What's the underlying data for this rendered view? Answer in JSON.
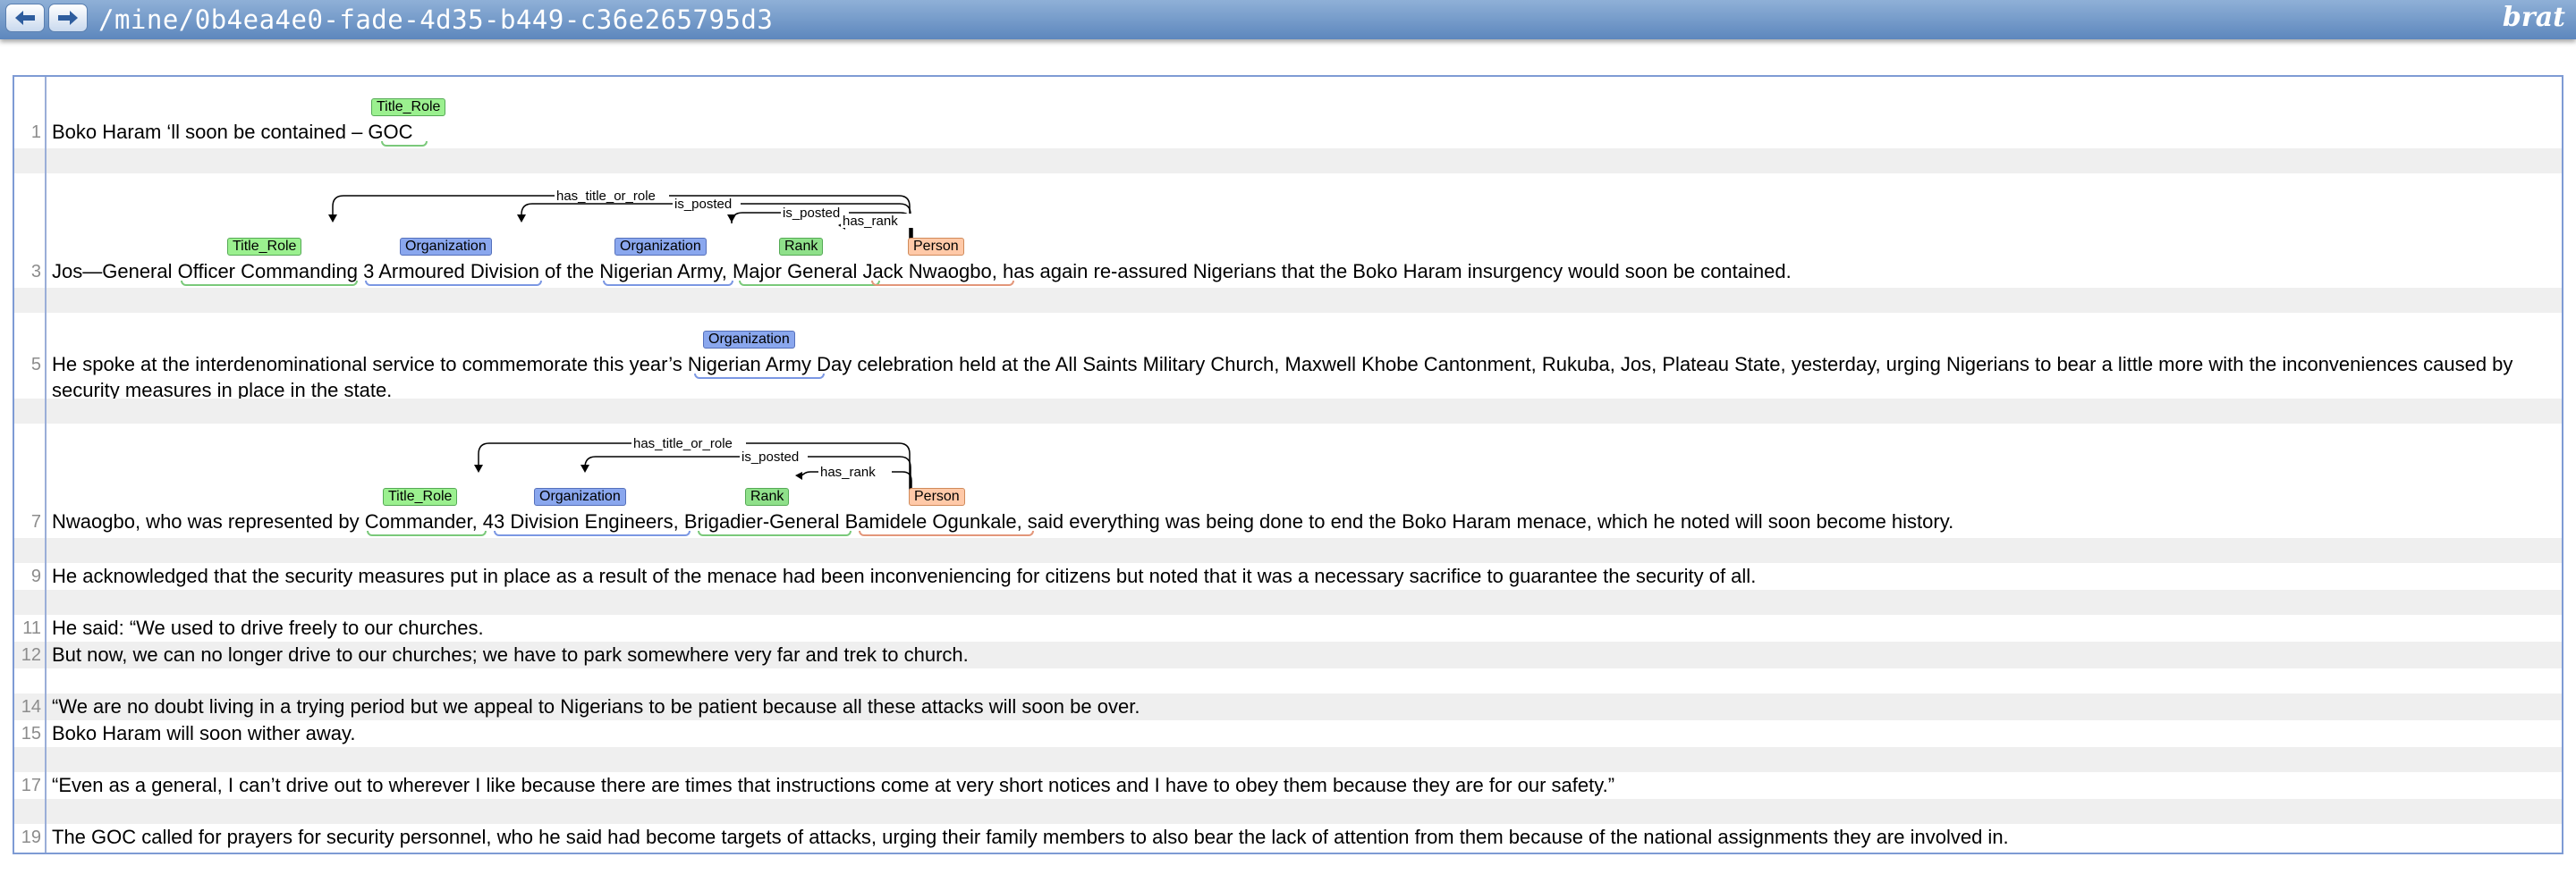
{
  "header": {
    "path": "/mine/0b4ea4e0-fade-4d35-b449-c36e265795d3",
    "logo": "brat",
    "back_icon": "arrow-left-icon",
    "forward_icon": "arrow-right-icon"
  },
  "colors": {
    "title_role": "#9bf08f",
    "organization": "#8aa7ee",
    "rank": "#8fe08a",
    "person": "#ffc9a8"
  },
  "lines": [
    {
      "num": "1",
      "text": "Boko Haram ‘ll soon be contained –   GOC"
    },
    {
      "num": "3",
      "text": "Jos—General Officer Commanding 3 Armoured Division of the Nigerian Army, Major General Jack Nwaogbo, has again re-assured Nigerians that the Boko Haram insurgency would soon be contained."
    },
    {
      "num": "5",
      "text": "He spoke at the interdenominational service to commemorate this year’s Nigerian Army Day celebration held at the All Saints Military Church, Maxwell Khobe Cantonment, Rukuba, Jos, Plateau State, yesterday, urging Nigerians to bear a little more with the inconveniences caused by",
      "text2": "security measures in place in the state."
    },
    {
      "num": "7",
      "text": "Nwaogbo, who was represented by Commander, 43 Division Engineers, Brigadier-General Bamidele Ogunkale, said everything was being done to end the Boko Haram menace, which he noted will soon become history."
    },
    {
      "num": "9",
      "text": "He acknowledged that the security measures put in place as a result of the menace had been inconveniencing for citizens but noted that it was a necessary sacrifice to guarantee the security of all."
    },
    {
      "num": "11",
      "text": "He said: “We used to drive freely to our churches."
    },
    {
      "num": "12",
      "text": "But now, we can no longer drive to our churches; we have to park somewhere very far and trek to church."
    },
    {
      "num": "14",
      "text": "“We are no doubt living in a trying period but we appeal to Nigerians to be patient because all these attacks will soon be over."
    },
    {
      "num": "15",
      "text": "Boko Haram will soon wither away."
    },
    {
      "num": "17",
      "text": "“Even as a general, I can’t drive out to wherever I like because there are times that instructions come at very short notices and I have to obey them because they are for our safety.”"
    },
    {
      "num": "19",
      "text": "The GOC called for prayers for security personnel, who he said had become targets of attacks, urging their family members to also bear the lack of attention from them because of the national assignments they are involved in."
    }
  ],
  "labels": {
    "title_role": "Title_Role",
    "organization": "Organization",
    "rank": "Rank",
    "person": "Person"
  },
  "relations": {
    "has_title_or_role": "has_title_or_role",
    "is_posted": "is_posted",
    "has_rank": "has_rank"
  }
}
